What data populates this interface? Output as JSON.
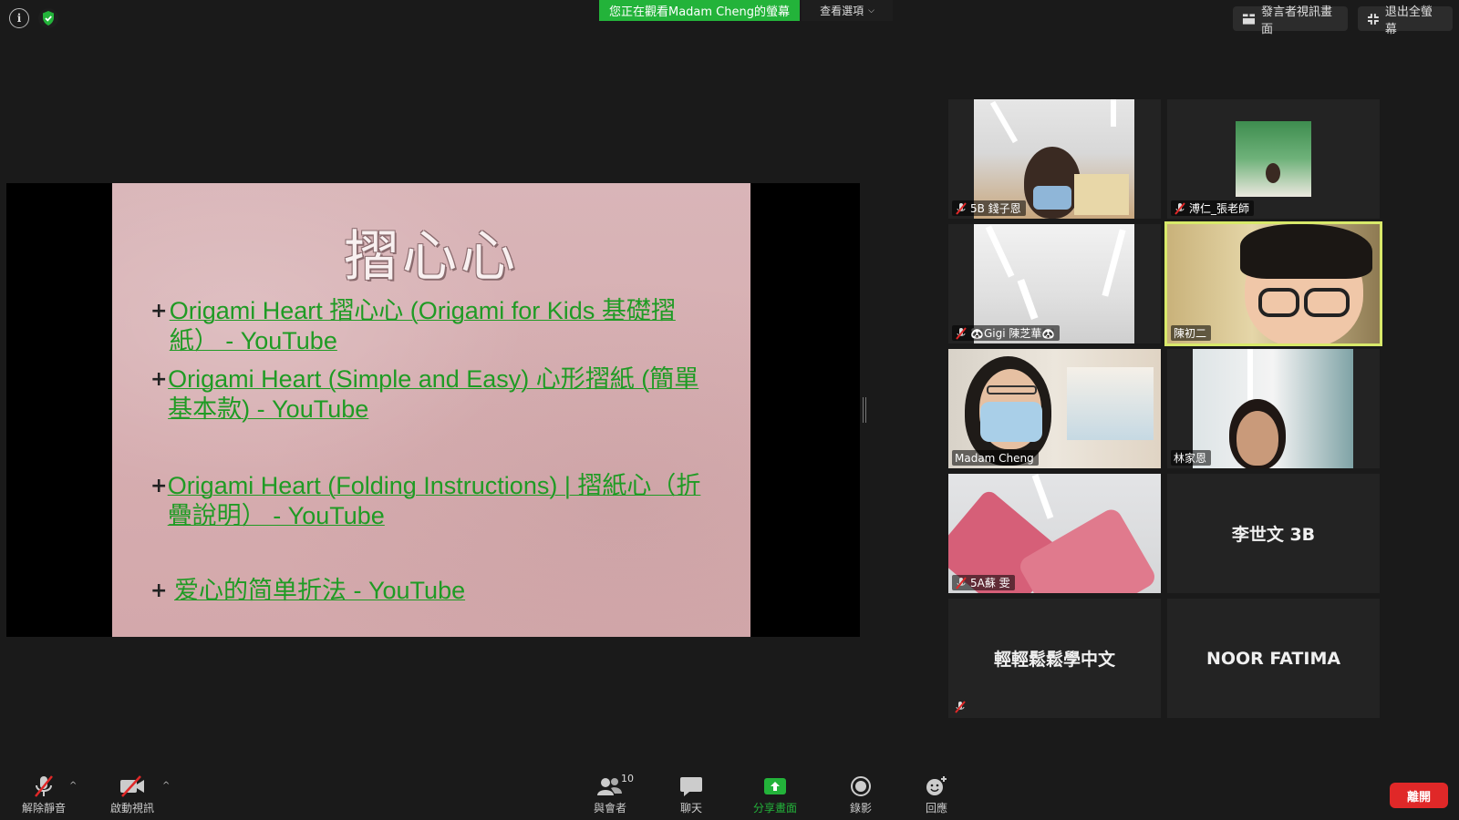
{
  "top_bar": {
    "viewing_banner": "您正在觀看Madam  Cheng的螢幕",
    "view_options_label": "查看選項",
    "speaker_view_label": "發言者視訊畫面",
    "exit_fullscreen_label": "退出全螢幕"
  },
  "slide": {
    "title": "摺心心",
    "bullets": [
      {
        "mark": "+",
        "text": "Origami Heart 摺心心 (Origami for Kids 基礎摺紙） - YouTube"
      },
      {
        "mark": "+",
        "text": "Origami Heart (Simple and Easy) 心形摺紙 (簡單基本款) - YouTube"
      },
      {
        "mark": "+",
        "text": "Origami Heart (Folding Instructions) | 摺紙心（折疊說明） - YouTube"
      },
      {
        "mark": "+",
        "text": "爱心的简单折法 - YouTube"
      }
    ]
  },
  "participants": [
    {
      "name": "5B 錢子恩",
      "muted": true
    },
    {
      "name": "溥仁_張老師",
      "muted": true
    },
    {
      "name": "🐼Gigi 陳芝華🐼",
      "muted": true
    },
    {
      "name": "陳初二",
      "muted": false,
      "active_speaker": true
    },
    {
      "name": "Madam Cheng",
      "muted": false
    },
    {
      "name": "林家恩",
      "muted": false
    },
    {
      "name": "5A蘇 雯",
      "muted": true
    },
    {
      "name": "李世文 3B",
      "muted": false,
      "video_off": true
    },
    {
      "name": "輕輕鬆鬆學中文",
      "muted": true,
      "video_off": true
    },
    {
      "name": "NOOR FATIMA",
      "muted": false,
      "video_off": true
    }
  ],
  "toolbar": {
    "unmute_label": "解除靜音",
    "start_video_label": "啟動視訊",
    "participants_label": "與會者",
    "participants_count": "10",
    "chat_label": "聊天",
    "share_label": "分享畫面",
    "record_label": "錄影",
    "reactions_label": "回應",
    "leave_label": "離開"
  },
  "colors": {
    "accent_green": "#23b33a",
    "leave_red": "#e02828",
    "active_speaker_border": "#d8e96a",
    "link_green": "#1f9b24"
  }
}
